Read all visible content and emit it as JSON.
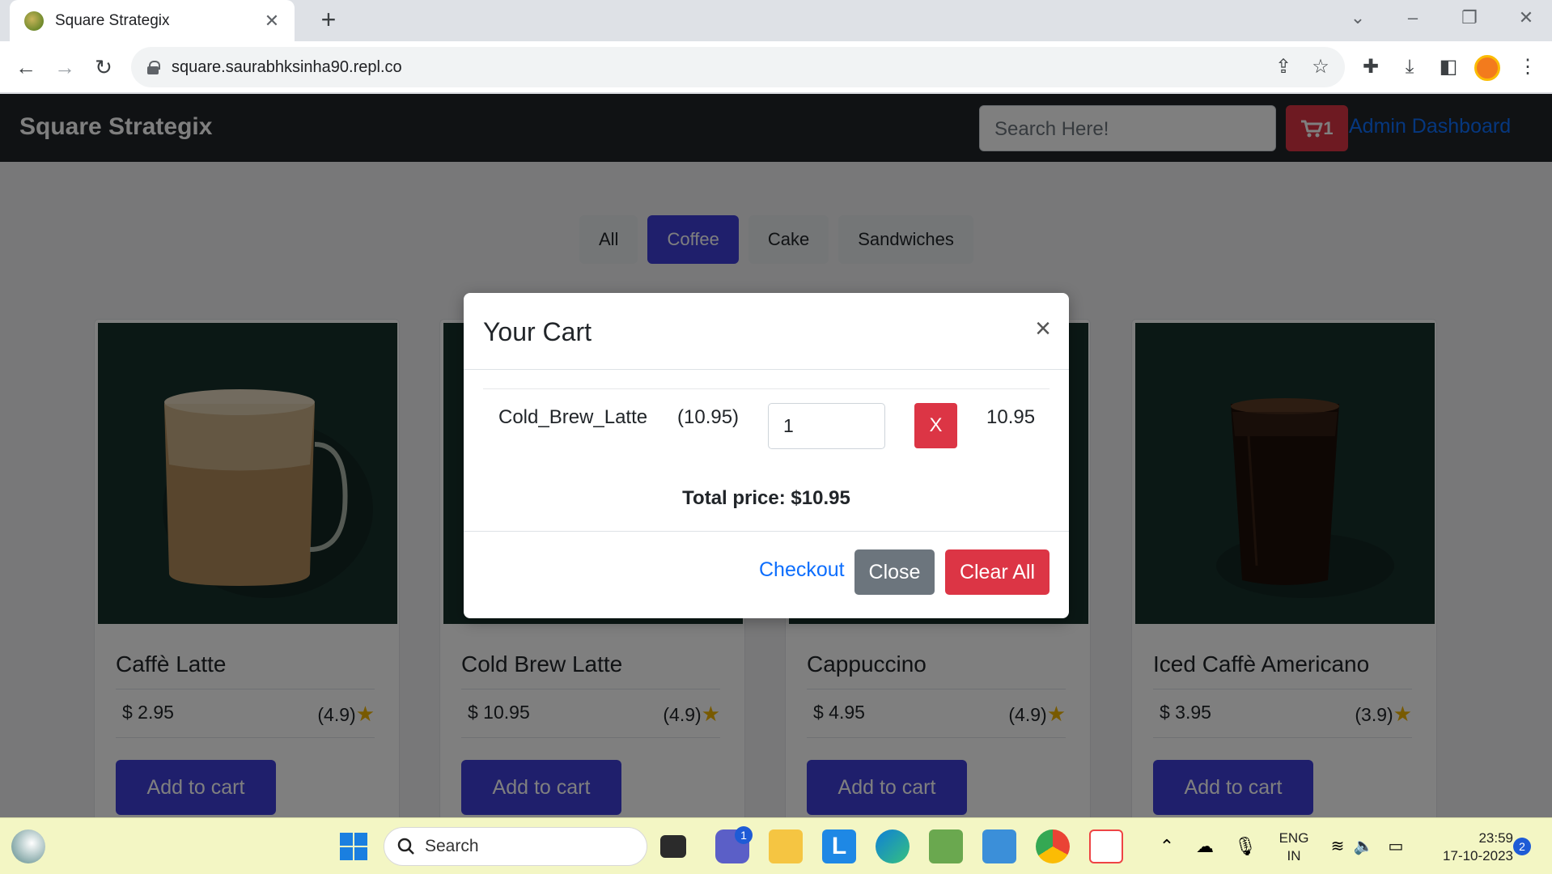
{
  "browser": {
    "tab_title": "Square Strategix",
    "url": "square.saurabhksinha90.repl.co"
  },
  "site": {
    "brand": "Square Strategix",
    "search_placeholder": "Search Here!",
    "cart_count": "1",
    "admin_link": "Admin Dashboard"
  },
  "filters": [
    {
      "label": "All",
      "active": false
    },
    {
      "label": "Coffee",
      "active": true
    },
    {
      "label": "Cake",
      "active": false
    },
    {
      "label": "Sandwiches",
      "active": false
    }
  ],
  "products": [
    {
      "name": "Caffè Latte",
      "price": "$ 2.95",
      "rating": "(4.9)",
      "button": "Add to cart"
    },
    {
      "name": "Cold Brew Latte",
      "price": "$ 10.95",
      "rating": "(4.9)",
      "button": "Add to cart"
    },
    {
      "name": "Cappuccino",
      "price": "$ 4.95",
      "rating": "(4.9)",
      "button": "Add to cart"
    },
    {
      "name": "Iced Caffè Americano",
      "price": "$ 3.95",
      "rating": "(3.9)",
      "button": "Add to cart"
    }
  ],
  "cart_modal": {
    "title": "Your Cart",
    "close_icon": "×",
    "item": {
      "name": "Cold_Brew_Latte",
      "unit_price": "(10.95)",
      "quantity": "1",
      "remove_label": "X",
      "line_total": "10.95"
    },
    "total": "Total price: $10.95",
    "checkout_label": "Checkout",
    "close_label": "Close",
    "clear_label": "Clear All"
  },
  "taskbar": {
    "search_label": "Search",
    "chat_badge": "1",
    "lang_line1": "ENG",
    "lang_line2": "IN",
    "time": "23:59",
    "date": "17-10-2023",
    "notification_count": "2"
  },
  "colors": {
    "accent": "#3f3fd8",
    "danger": "#dc3545",
    "secondary": "#6c757d",
    "navbar": "#212529",
    "link": "#0d6efd"
  }
}
